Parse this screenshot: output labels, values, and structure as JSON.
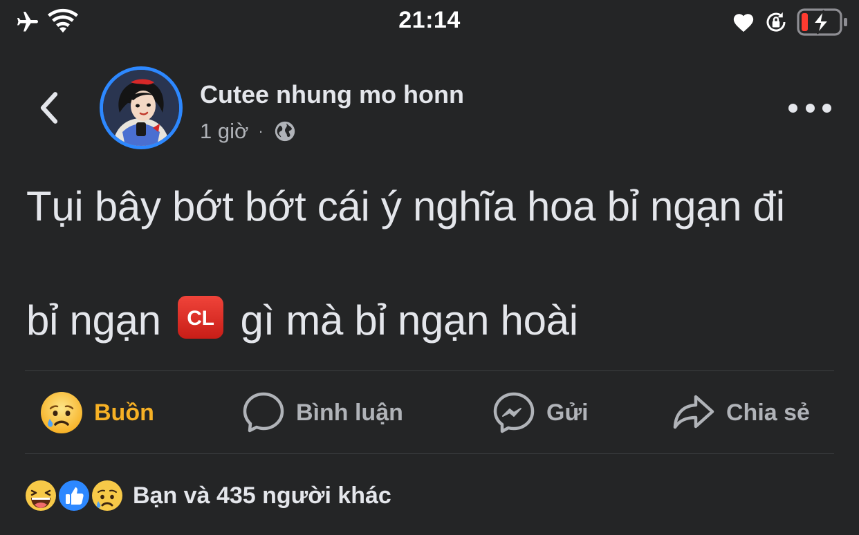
{
  "status_bar": {
    "time": "21:14",
    "icons": [
      "airplane-icon",
      "wifi-icon",
      "heart-icon",
      "rotation-lock-icon",
      "battery-charging-icon"
    ]
  },
  "post": {
    "author": "Cutee nhung mo honn",
    "time_ago": "1 giờ",
    "separator": "·",
    "audience_icon": "globe-icon",
    "text_line1": "Tụi bây bớt bớt cái ý nghĩa hoa bỉ ngạn đi",
    "text_line2_before": "bỉ ngạn",
    "emoji_label": "CL",
    "text_line2_after": "gì mà bỉ ngạn hoài"
  },
  "actions": {
    "reaction_label": "Buồn",
    "comment_label": "Bình luận",
    "send_label": "Gửi",
    "share_label": "Chia sẻ"
  },
  "reactions_summary": {
    "icons": [
      "haha-icon",
      "like-icon",
      "sad-icon"
    ],
    "text": "Bạn và 435 người khác"
  },
  "colors": {
    "background": "#242526",
    "text_primary": "#e4e6eb",
    "text_secondary": "#b0b3b8",
    "sad_reaction": "#f7b125",
    "like_blue": "#2d88ff",
    "avatar_ring": "#2d88ff"
  }
}
